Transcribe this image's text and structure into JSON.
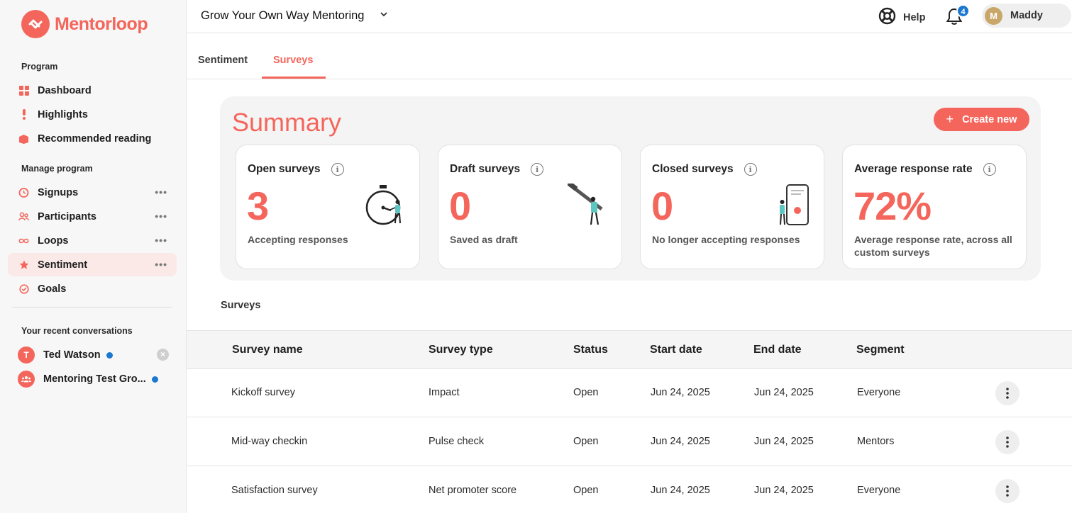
{
  "brand": {
    "name": "Mentorloop",
    "accent": "#f4665c"
  },
  "sidebar": {
    "program_label": "Program",
    "program_items": [
      {
        "label": "Dashboard",
        "icon": "dashboard-grid-icon"
      },
      {
        "label": "Highlights",
        "icon": "highlight-icon"
      },
      {
        "label": "Recommended reading",
        "icon": "book-icon"
      }
    ],
    "manage_label": "Manage program",
    "manage_items": [
      {
        "label": "Signups",
        "icon": "signup-icon",
        "more": "•••"
      },
      {
        "label": "Participants",
        "icon": "participants-icon",
        "more": "•••"
      },
      {
        "label": "Loops",
        "icon": "loops-icon",
        "more": "•••"
      },
      {
        "label": "Sentiment",
        "icon": "star-icon",
        "more": "•••",
        "active": true
      },
      {
        "label": "Goals",
        "icon": "goals-icon"
      }
    ],
    "conversations_label": "Your recent conversations",
    "conversations": [
      {
        "initial": "T",
        "name": "Ted Watson"
      },
      {
        "initial": "",
        "name": "Mentoring Test Gro..."
      }
    ]
  },
  "topbar": {
    "program_title": "Grow Your Own Way Mentoring",
    "help_label": "Help",
    "notification_count": "4",
    "user_initial": "M",
    "user_name": "Maddy"
  },
  "tabs": [
    {
      "label": "Sentiment"
    },
    {
      "label": "Surveys",
      "active": true
    }
  ],
  "summary": {
    "title": "Summary",
    "create_label": "Create new",
    "cards": [
      {
        "title": "Open surveys",
        "value": "3",
        "sub": "Accepting responses"
      },
      {
        "title": "Draft surveys",
        "value": "0",
        "sub": "Saved as draft"
      },
      {
        "title": "Closed surveys",
        "value": "0",
        "sub": "No longer accepting responses"
      },
      {
        "title": "Average response rate",
        "value": "72%",
        "sub": "Average response rate, across all custom surveys"
      }
    ]
  },
  "surveys": {
    "label": "Surveys",
    "columns": [
      "Survey name",
      "Survey type",
      "Status",
      "Start date",
      "End date",
      "Segment"
    ],
    "rows": [
      {
        "name": "Kickoff survey",
        "type": "Impact",
        "status": "Open",
        "start": "Jun 24, 2025",
        "end": "Jun 24, 2025",
        "segment": "Everyone"
      },
      {
        "name": "Mid-way checkin",
        "type": "Pulse check",
        "status": "Open",
        "start": "Jun 24, 2025",
        "end": "Jun 24, 2025",
        "segment": "Mentors"
      },
      {
        "name": "Satisfaction survey",
        "type": "Net promoter score",
        "status": "Open",
        "start": "Jun 24, 2025",
        "end": "Jun 24, 2025",
        "segment": "Everyone"
      }
    ]
  }
}
